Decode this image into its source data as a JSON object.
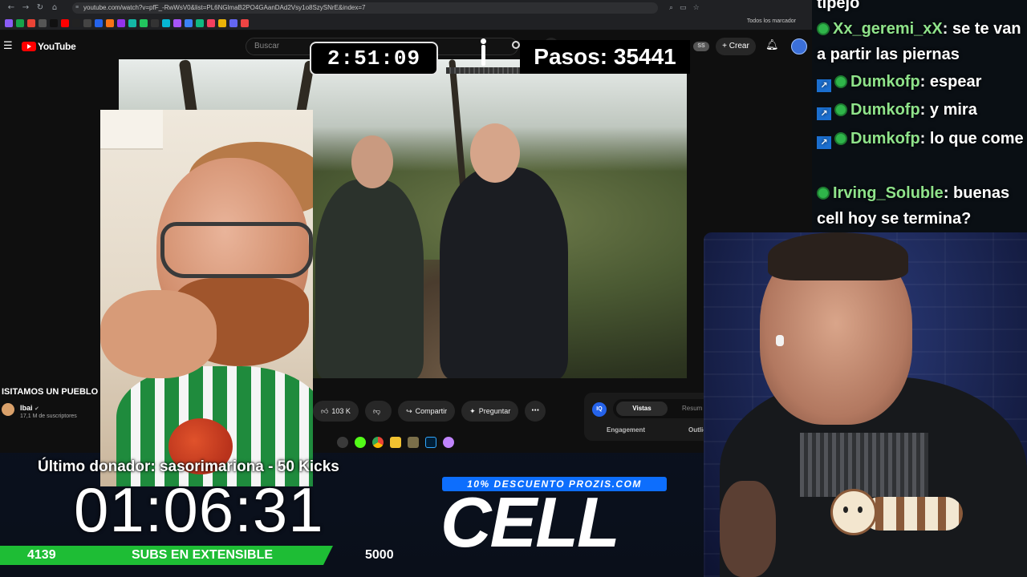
{
  "browser": {
    "url": "youtube.com/watch?v=pfF_-RwWsV0&list=PL6NGlmaB2PO4GAanDAd2Vsy1o8SzySNrE&index=7",
    "bookmarks_folder": "Todos los marcador",
    "youtube": {
      "logo_text": "YouTube",
      "search_placeholder": "Buscar",
      "badge": "SS",
      "create_label": "Crear"
    },
    "video": {
      "title": "ISITAMOS UN PUEBLO",
      "channel": "Ibai",
      "subscribers": "17,1 M de suscriptores",
      "likes": "103 K",
      "share_label": "Compartir",
      "ask_label": "Preguntar",
      "more_label": "⋯"
    },
    "side_panel": {
      "logo": "IQ",
      "tab_active": "Vistas",
      "tab_inactive": "Resum",
      "label_1": "Engagement",
      "label_2": "Outlie"
    }
  },
  "overlays": {
    "stream_timer": "2:51:09",
    "steps": "Pasos: 35441",
    "donor": "Último donador: sasorimariona - 50 Kicks",
    "countdown": "01:06:31",
    "subs": {
      "current": "4139",
      "label": "SUBS EN EXTENSIBLE",
      "goal": "5000",
      "progress_fraction": 0.83
    },
    "promo": "10% DESCUENTO PROZIS.COM",
    "brand": "CELL"
  },
  "chat": {
    "messages": [
      {
        "user": "",
        "text": "tipejo",
        "badge": "none"
      },
      {
        "user": "Xx_geremi_xX",
        "text": "se te van a partir las piernas",
        "badge": "green"
      },
      {
        "user": "Dumkofp",
        "text": "espear",
        "badge": "blue-green"
      },
      {
        "user": "Dumkofp",
        "text": "y mira",
        "badge": "blue-green"
      },
      {
        "user": "Dumkofp",
        "text": "lo que come",
        "badge": "blue-green"
      },
      {
        "user": "Irving_Soluble",
        "text": "buenas cell hoy se termina?",
        "badge": "green"
      }
    ],
    "separator": ":"
  },
  "colors": {
    "chat_username": "#8fe38a",
    "progress_green": "#1ebd35",
    "promo_blue": "#0d6efd",
    "youtube_red": "#ff0000"
  },
  "icons": [
    "back-arrow-icon",
    "forward-arrow-icon",
    "reload-icon",
    "home-icon",
    "hamburger-menu-icon",
    "search-icon",
    "microphone-icon",
    "bell-icon",
    "like-icon",
    "dislike-icon",
    "share-icon",
    "sparkle-icon",
    "walker-icon",
    "ferret-sticker-icon"
  ]
}
